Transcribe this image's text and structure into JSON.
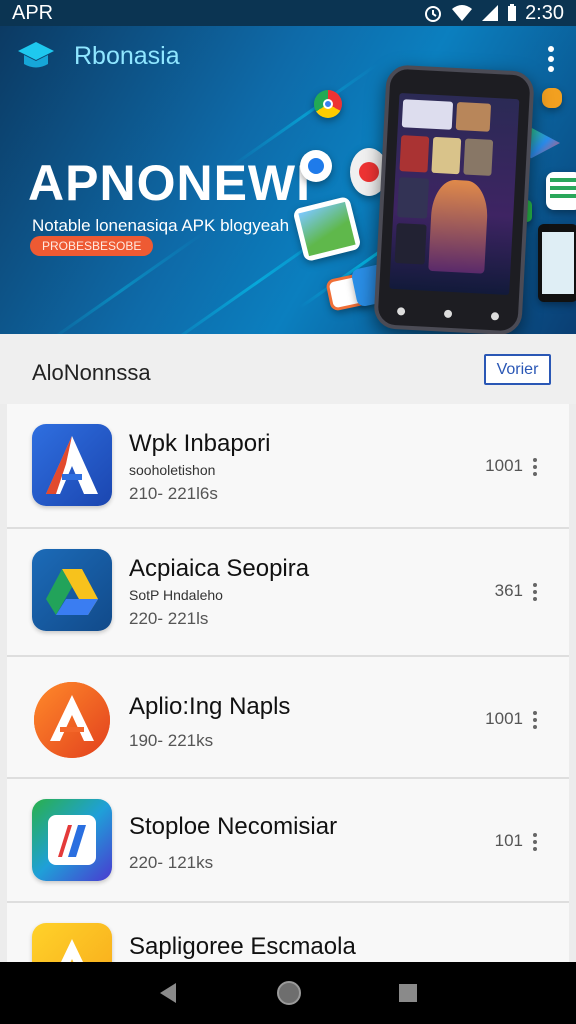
{
  "status_bar": {
    "carrier": "APR",
    "time": "2:30"
  },
  "header": {
    "brand_name": "Rbonasia"
  },
  "hero": {
    "title": "APNONEWI",
    "subtitle": "Notable lonenasiqa APK blogyeah",
    "badge": "PROBESBESOBE"
  },
  "section": {
    "title": "AloNonnssa",
    "view_button": "Vorier"
  },
  "apps": [
    {
      "title": "Wpk Inbapori",
      "subtitle": "sooholetishon",
      "meta": "210- 221l6s",
      "count": "1001",
      "icon": "a-logo-red-icon"
    },
    {
      "title": "Acpiaica Seopira",
      "subtitle": "SotP Hndaleho",
      "meta": "220- 221ls",
      "count": "361",
      "icon": "drive-triangle-icon"
    },
    {
      "title": "Aplio:Ing Napls",
      "subtitle": "",
      "meta": "190- 221ks",
      "count": "1001",
      "icon": "a-logo-orange-icon"
    },
    {
      "title": "Stoploe Necomisiar",
      "subtitle": "",
      "meta": "220- 121ks",
      "count": "101",
      "icon": "multicolor-n-icon"
    },
    {
      "title": "Sapligoree Escmaola",
      "subtitle": "",
      "meta": "",
      "count": "",
      "icon": "a-logo-yellow-icon"
    }
  ],
  "colors": {
    "accent": "#2a57b5",
    "hero_bg": "#0e6aa8",
    "pill": "#ee5a33"
  }
}
